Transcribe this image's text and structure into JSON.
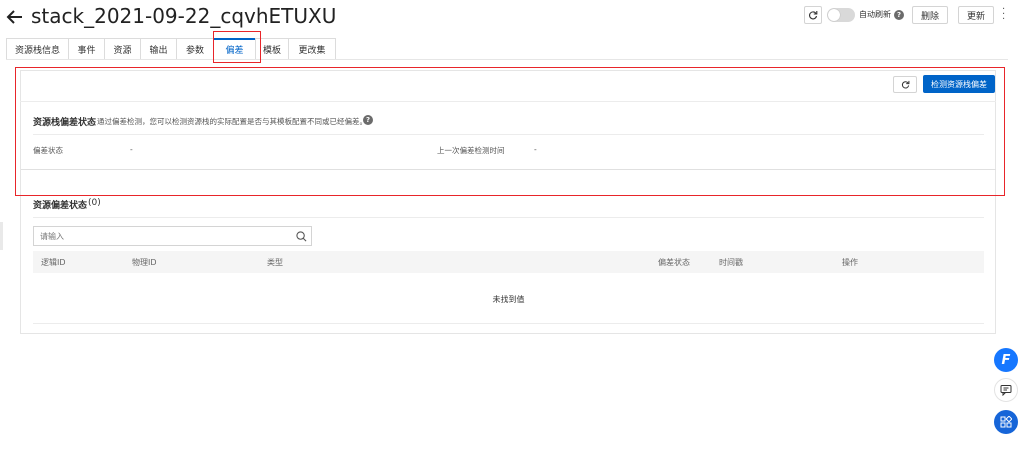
{
  "header": {
    "title": "stack_2021-09-22_cqvhETUXU",
    "auto_refresh_label": "自动刷新",
    "delete_label": "删除",
    "update_label": "更新"
  },
  "tabs": [
    {
      "label": "资源栈信息"
    },
    {
      "label": "事件"
    },
    {
      "label": "资源"
    },
    {
      "label": "输出"
    },
    {
      "label": "参数"
    },
    {
      "label": "偏差"
    },
    {
      "label": "模板"
    },
    {
      "label": "更改集"
    }
  ],
  "drift": {
    "detect_button": "检测资源栈偏差",
    "status_title": "资源栈偏差状态",
    "status_desc": "通过偏差检测，您可以检测资源栈的实际配置是否与其模板配置不同或已经偏差。",
    "status_label": "偏差状态",
    "status_value": "-",
    "last_check_label": "上一次偏差检测时间",
    "last_check_value": "-"
  },
  "resource_drift": {
    "title": "资源偏差状态",
    "count": "(0)",
    "search_placeholder": "请输入",
    "columns": [
      "逻辑ID",
      "物理ID",
      "类型",
      "偏差状态",
      "时间戳",
      "操作"
    ],
    "empty_text": "未找到值"
  },
  "colors": {
    "accent": "#0064c8",
    "highlight": "#e8252a"
  }
}
